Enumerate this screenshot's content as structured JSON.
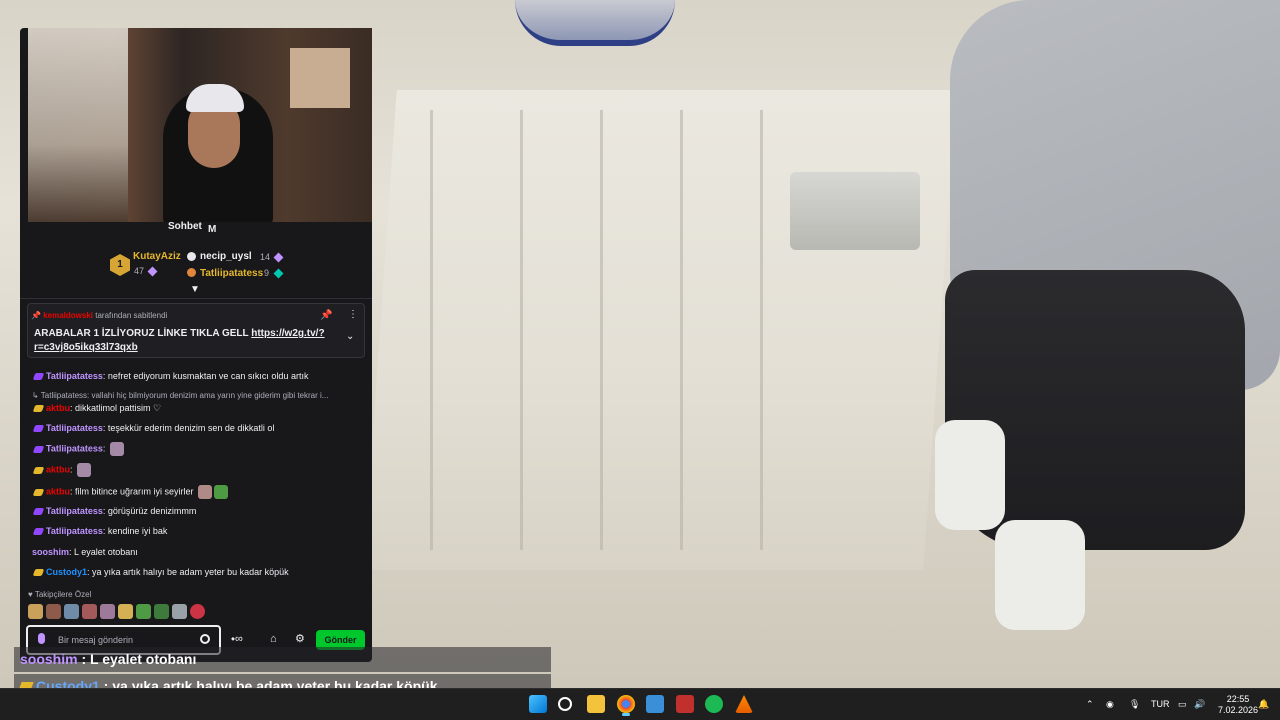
{
  "chat": {
    "title": "Sohbet",
    "title_suffix": "M",
    "leaderboard": {
      "first": {
        "rank": "1",
        "name": "KutayAziz",
        "points": "47"
      },
      "second": {
        "name": "necip_uysl",
        "points": "14"
      },
      "third": {
        "name": "Tatliipatatess",
        "points": "9"
      }
    },
    "pinned": {
      "pinned_by_user": "kemaldowski",
      "pinned_by_suffix": " tarafından sabitlendi",
      "text": "ARABALAR 1 İZLİYORUZ LİNKE TIKLA GELL ",
      "link": "https://w2g.tv/?r=c3vj8o5ikq33l73qxb"
    },
    "messages": [
      {
        "user": "Tatliipatatess",
        "text": ": nefret ediyorum kusmaktan ve can sıkıcı oldu artık"
      },
      {
        "reply": "Tatliipatatess: vallahi hiç bilmiyorum denizim ama yarın yine giderim gibi tekrar i..."
      },
      {
        "user": "aktbu",
        "text": ": dikkatlimol pattisim ♡"
      },
      {
        "user": "Tatliipatatess",
        "text": ": teşekkür ederim denizim sen de dikkatli ol"
      },
      {
        "user": "Tatliipatatess",
        "text": ":"
      },
      {
        "user": "aktbu",
        "text": ":"
      },
      {
        "user": "aktbu",
        "text": ": film bitince uğrarım iyi seyirler"
      },
      {
        "user": "Tatliipatatess",
        "text": ": görüşürüz denizimmm"
      },
      {
        "user": "Tatliipatatess",
        "text": ": kendine iyi bak"
      },
      {
        "user": "sooshim",
        "text": ": L eyalet otobanı"
      },
      {
        "user": "Custody1",
        "text": ": ya yıka artık halıyı be adam yeter bu kadar köpük"
      }
    ],
    "emote_section_title": "Takipçilere Özel",
    "input_placeholder": "Bir mesaj gönderin",
    "send_label": "Gönder"
  },
  "overlay": {
    "line1_user": "sooshim",
    "line1_text": " : L eyalet otobanı",
    "line2_user": "Custody1",
    "line2_text": " : ya yıka artık halıyı be adam yeter bu kadar köpük"
  },
  "taskbar": {
    "language": "TUR",
    "time": "22:55",
    "date": "7.02.2026"
  },
  "colors": {
    "accent_purple": "#9147ff",
    "send_green": "#00c72c",
    "username_red": "#eb0400",
    "username_gold": "#e5b72d"
  }
}
